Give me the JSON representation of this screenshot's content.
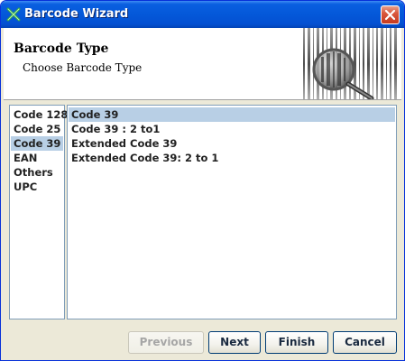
{
  "window": {
    "title": "Barcode Wizard",
    "icons": {
      "app": "barcode-wizard-icon",
      "close": "close-icon",
      "header_art": "barcode-magnifier-icon"
    }
  },
  "header": {
    "title": "Barcode Type",
    "subtitle": "Choose Barcode Type"
  },
  "categories": {
    "selected": "Code 39",
    "items": [
      "Code 128",
      "Code 25",
      "Code 39",
      "EAN",
      "Others",
      "UPC"
    ]
  },
  "types": {
    "selected": "Code 39",
    "items": [
      "Code 39",
      "Code 39 : 2 to1",
      "Extended Code 39",
      "Extended Code 39: 2 to 1"
    ]
  },
  "buttons": {
    "previous": "Previous",
    "next": "Next",
    "finish": "Finish",
    "cancel": "Cancel"
  },
  "colors": {
    "titlebar": "#0458d9",
    "selection": "#b8cfe5",
    "close": "#d9583d"
  }
}
